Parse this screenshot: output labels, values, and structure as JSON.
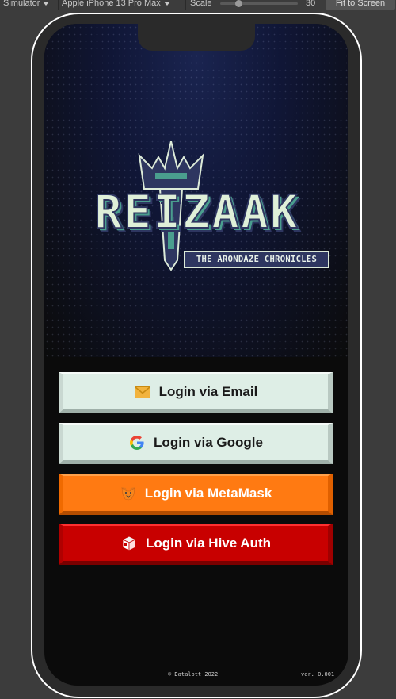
{
  "toolbar": {
    "view_mode": "Simulator",
    "device": "Apple iPhone 13 Pro Max",
    "scale_label": "Scale",
    "scale_value": "30",
    "fit_button": "Fit to Screen"
  },
  "game": {
    "logo_title": "REIZAAK",
    "logo_subtitle": "THE ARONDAZE CHRONICLES",
    "buttons": [
      {
        "label": "Login via Email",
        "icon": "envelope-icon"
      },
      {
        "label": "Login via Google",
        "icon": "google-icon"
      },
      {
        "label": "Login via MetaMask",
        "icon": "metamask-fox-icon"
      },
      {
        "label": "Login via Hive Auth",
        "icon": "hive-cube-icon"
      }
    ],
    "copyright": "© Datalott 2022",
    "version": "ver. 0.001"
  },
  "colors": {
    "email_btn": "#deeee6",
    "google_btn": "#deeee6",
    "metamask_btn": "#ff7a12",
    "hive_btn": "#c80000"
  }
}
